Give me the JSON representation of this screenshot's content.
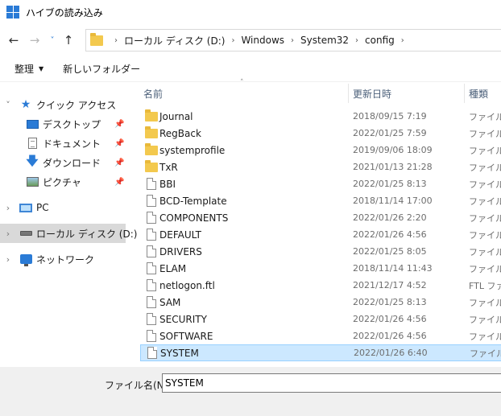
{
  "window": {
    "title": "ハイブの読み込み"
  },
  "address": {
    "crumbs": [
      "ローカル ディスク (D:)",
      "Windows",
      "System32",
      "config"
    ]
  },
  "toolbar": {
    "organize": "整理",
    "new_folder": "新しいフォルダー"
  },
  "sidebar": {
    "quick_access": "クイック アクセス",
    "items": [
      {
        "label": "デスクトップ",
        "icon": "desktop-icon"
      },
      {
        "label": "ドキュメント",
        "icon": "documents-icon"
      },
      {
        "label": "ダウンロード",
        "icon": "download-icon"
      },
      {
        "label": "ピクチャ",
        "icon": "pictures-icon"
      }
    ],
    "pc": "PC",
    "local_disk": "ローカル ディスク (D:)",
    "network": "ネットワーク"
  },
  "columns": {
    "name": "名前",
    "date": "更新日時",
    "type": "種類"
  },
  "files": [
    {
      "name": "Journal",
      "date": "2018/09/15 7:19",
      "type": "ファイル",
      "kind": "folder"
    },
    {
      "name": "RegBack",
      "date": "2022/01/25 7:59",
      "type": "ファイル",
      "kind": "folder"
    },
    {
      "name": "systemprofile",
      "date": "2019/09/06 18:09",
      "type": "ファイル",
      "kind": "folder"
    },
    {
      "name": "TxR",
      "date": "2021/01/13 21:28",
      "type": "ファイル",
      "kind": "folder"
    },
    {
      "name": "BBI",
      "date": "2022/01/25 8:13",
      "type": "ファイル",
      "kind": "file"
    },
    {
      "name": "BCD-Template",
      "date": "2018/11/14 17:00",
      "type": "ファイル",
      "kind": "file"
    },
    {
      "name": "COMPONENTS",
      "date": "2022/01/26 2:20",
      "type": "ファイル",
      "kind": "file"
    },
    {
      "name": "DEFAULT",
      "date": "2022/01/26 4:56",
      "type": "ファイル",
      "kind": "file"
    },
    {
      "name": "DRIVERS",
      "date": "2022/01/25 8:05",
      "type": "ファイル",
      "kind": "file"
    },
    {
      "name": "ELAM",
      "date": "2018/11/14 11:43",
      "type": "ファイル",
      "kind": "file"
    },
    {
      "name": "netlogon.ftl",
      "date": "2021/12/17 4:52",
      "type": "FTL ファ",
      "kind": "file"
    },
    {
      "name": "SAM",
      "date": "2022/01/25 8:13",
      "type": "ファイル",
      "kind": "file"
    },
    {
      "name": "SECURITY",
      "date": "2022/01/26 4:56",
      "type": "ファイル",
      "kind": "file"
    },
    {
      "name": "SOFTWARE",
      "date": "2022/01/26 4:56",
      "type": "ファイル",
      "kind": "file"
    },
    {
      "name": "SYSTEM",
      "date": "2022/01/26 6:40",
      "type": "ファイル",
      "kind": "file",
      "selected": true
    }
  ],
  "filename": {
    "label": "ファイル名(N):",
    "value": "SYSTEM"
  }
}
